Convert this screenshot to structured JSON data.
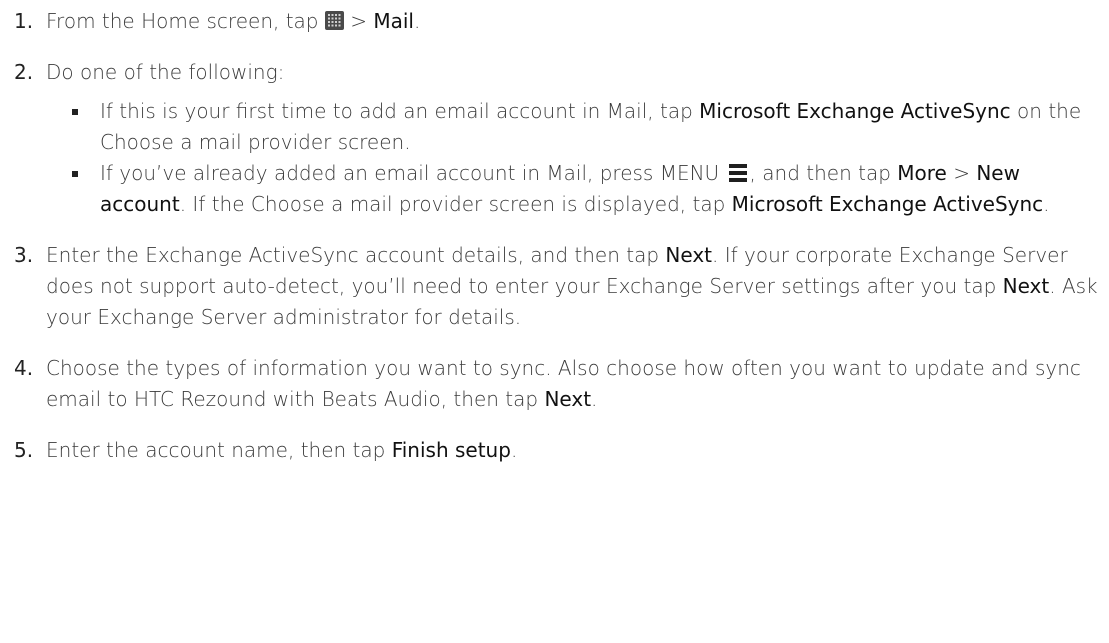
{
  "steps": [
    {
      "number": "1.",
      "text_pre": "From the Home screen, tap ",
      "icon": "all-apps-grid-icon",
      "text_sep": " > ",
      "mail": "Mail",
      "text_end": "."
    },
    {
      "number": "2.",
      "text": "Do one of the following:",
      "bullets": [
        {
          "t1": "If this is your first time to add an email account in Mail, tap ",
          "h1": "Microsoft Exchange ActiveSync",
          "t2": " on the Choose a mail provider screen."
        },
        {
          "t1": "If you’ve already added an email account in Mail, press MENU ",
          "icon": "menu-icon",
          "t2": ", and then tap ",
          "h1": "More",
          "t3": " > ",
          "h2": "New account",
          "t4": ". If the Choose a mail provider screen is displayed, tap ",
          "h3": "Microsoft Exchange ActiveSync",
          "t5": "."
        }
      ]
    },
    {
      "number": "3.",
      "t1": "Enter the Exchange ActiveSync account details, and then tap ",
      "h1": "Next",
      "t2": ". If your corporate Exchange Server does not support auto-detect, you’ll need to enter your Exchange Server settings after you tap ",
      "h2": "Next",
      "t3": ". Ask your Exchange Server administrator for details."
    },
    {
      "number": "4.",
      "t1": "Choose the types of information you want to sync. Also choose how often you want to update and sync email to HTC Rezound with Beats Audio, then tap ",
      "h1": "Next",
      "t2": "."
    },
    {
      "number": "5.",
      "t1": "Enter the account name, then tap ",
      "h1": "Finish setup",
      "t2": "."
    }
  ]
}
